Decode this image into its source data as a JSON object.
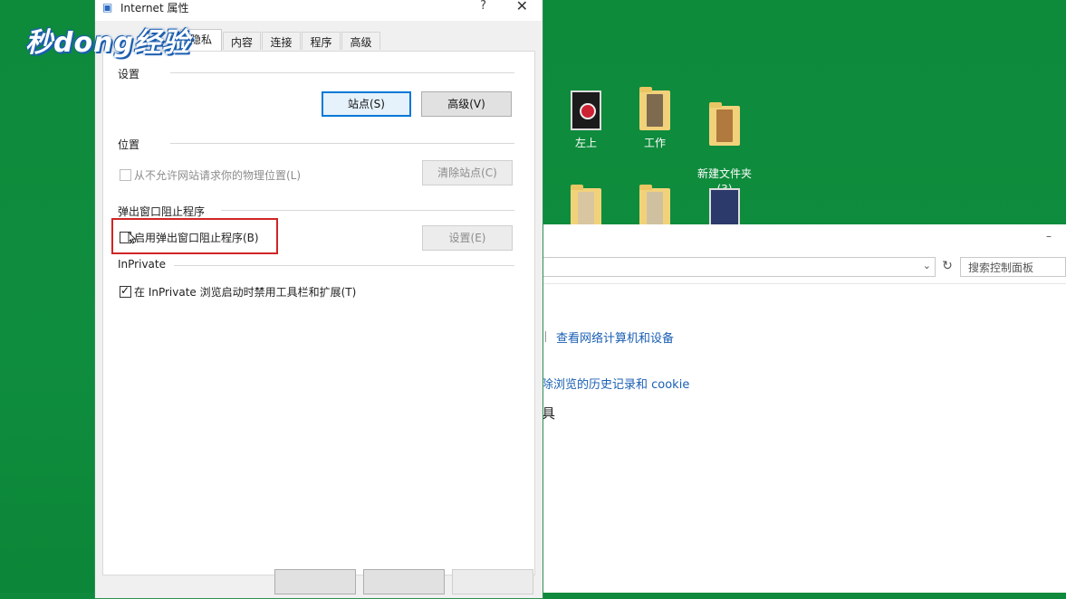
{
  "watermark": {
    "text": "秒dong经验"
  },
  "desktop": {
    "icons": [
      {
        "label": "左上",
        "kind": "photo"
      },
      {
        "label": "工作",
        "kind": "folder"
      },
      {
        "label": "新建文件夹\n(3)",
        "kind": "folder"
      },
      {
        "label": "",
        "kind": "folder"
      },
      {
        "label": "",
        "kind": "folder"
      },
      {
        "label": "",
        "kind": "photo"
      }
    ]
  },
  "control_panel": {
    "search_placeholder": "搜索控制面板",
    "link_view_network": "查看网络计算机和设备",
    "link_history": "除浏览的历史记录和 cookie",
    "partial_text": "具"
  },
  "dialog": {
    "title": "Internet 属性",
    "help_label": "?",
    "close_label": "✕",
    "tabs": [
      "隐私",
      "内容",
      "连接",
      "程序",
      "高级"
    ],
    "groups": {
      "settings": {
        "label": "设置",
        "sites_button": "站点(S)",
        "advanced_button": "高级(V)"
      },
      "location": {
        "label": "位置",
        "checkbox_label": "从不允许网站请求你的物理位置(L)",
        "clear_button": "清除站点(C)"
      },
      "popup": {
        "label": "弹出窗口阻止程序",
        "checkbox_label": "启用弹出窗口阻止程序(B)",
        "settings_button": "设置(E)"
      },
      "inprivate": {
        "label": "InPrivate",
        "checkbox_label": "在 InPrivate 浏览启动时禁用工具栏和扩展(T)"
      }
    }
  },
  "colors": {
    "desktop_bg": "#0f8a3c",
    "highlight": "#d02525",
    "link": "#1a5fb4",
    "focus": "#0078d7"
  }
}
